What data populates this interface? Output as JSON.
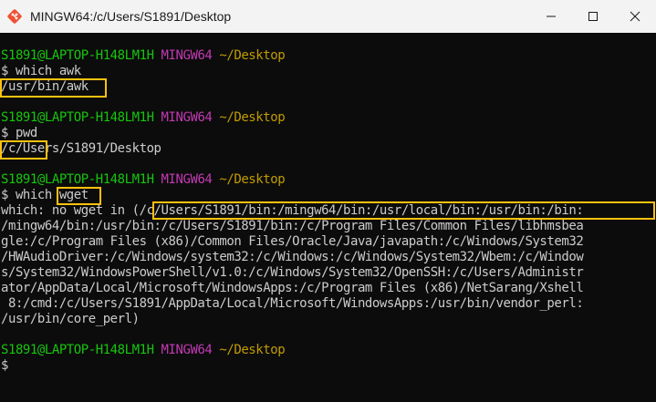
{
  "window": {
    "title": "MINGW64:/c/Users/S1891/Desktop",
    "icon": "git-bash-icon",
    "controls": {
      "minimize": "minimize-icon",
      "maximize": "maximize-icon",
      "close": "close-icon"
    }
  },
  "colors": {
    "background": "#0c0c0c",
    "text": "#cccccc",
    "prompt_user": "#16c60c",
    "prompt_mingw": "#c239b3",
    "prompt_path": "#c19c00",
    "highlight_box": "#ffc20e"
  },
  "terminal": {
    "prompt_user": "S1891@LAPTOP-H148LM1H",
    "prompt_env": "MINGW64",
    "prompt_path": "~/Desktop",
    "blocks": [
      {
        "command": "$ which awk",
        "output": [
          "/usr/bin/awk"
        ]
      },
      {
        "command": "$ pwd",
        "output": [
          "/c/Users/S1891/Desktop"
        ]
      },
      {
        "command": "$ which wget",
        "output": [
          "which: no wget in (/c/Users/S1891/bin:/mingw64/bin:/usr/local/bin:/usr/bin:/bin:",
          "/mingw64/bin:/usr/bin:/c/Users/S1891/bin:/c/Program Files/Common Files/libhmsbea",
          "gle:/c/Program Files (x86)/Common Files/Oracle/Java/javapath:/c/Windows/System32",
          "/HWAudioDriver:/c/Windows/system32:/c/Windows:/c/Windows/System32/Wbem:/c/Window",
          "s/System32/WindowsPowerShell/v1.0:/c/Windows/System32/OpenSSH:/c/Users/Administr",
          "ator/AppData/Local/Microsoft/WindowsApps:/c/Program Files (x86)/NetSarang/Xshell",
          " 8:/cmd:/c/Users/S1891/AppData/Local/Microsoft/WindowsApps:/usr/bin/vendor_perl:",
          "/usr/bin/core_perl)"
        ]
      }
    ],
    "final_prompt": "$"
  }
}
